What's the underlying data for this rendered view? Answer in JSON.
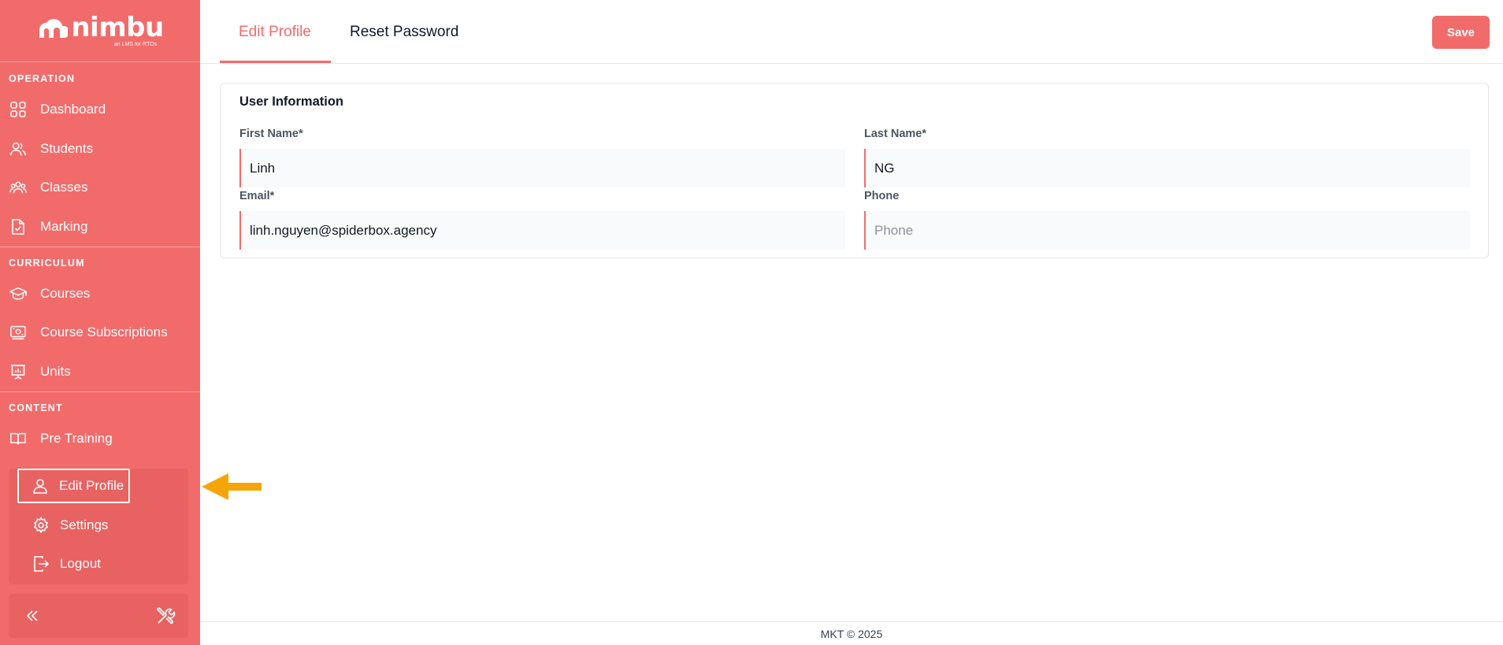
{
  "brand": {
    "name": "nimbu",
    "tagline": "an LMS for RTOs"
  },
  "sidebar": {
    "sections": [
      {
        "label": "OPERATION"
      },
      {
        "label": "CURRICULUM"
      },
      {
        "label": "CONTENT"
      }
    ],
    "items": [
      {
        "label": "Dashboard",
        "icon": "dashboard-icon"
      },
      {
        "label": "Students",
        "icon": "students-icon"
      },
      {
        "label": "Classes",
        "icon": "classes-icon"
      },
      {
        "label": "Marking",
        "icon": "marking-icon"
      },
      {
        "label": "Courses",
        "icon": "graduation-cap-icon"
      },
      {
        "label": "Course Subscriptions",
        "icon": "subscriptions-icon"
      },
      {
        "label": "Units",
        "icon": "presentation-chart-icon"
      },
      {
        "label": "Pre Training",
        "icon": "book-icon"
      }
    ],
    "account": [
      {
        "label": "Edit Profile",
        "icon": "user-icon"
      },
      {
        "label": "Settings",
        "icon": "gear-icon"
      },
      {
        "label": "Logout",
        "icon": "logout-icon"
      }
    ]
  },
  "tabs": [
    {
      "label": "Edit Profile",
      "active": true
    },
    {
      "label": "Reset Password",
      "active": false
    }
  ],
  "toolbar": {
    "save_label": "Save"
  },
  "form": {
    "title": "User Information",
    "first_name": {
      "label": "First Name*",
      "value": "Linh"
    },
    "last_name": {
      "label": "Last Name*",
      "value": "NG"
    },
    "email": {
      "label": "Email*",
      "value": "linh.nguyen@spiderbox.agency"
    },
    "phone": {
      "label": "Phone",
      "value": "",
      "placeholder": "Phone"
    }
  },
  "footer": {
    "text": "MKT © 2025"
  },
  "colors": {
    "accent": "#f26b6b",
    "panel": "#e86262",
    "arrow": "#f5a50a"
  }
}
